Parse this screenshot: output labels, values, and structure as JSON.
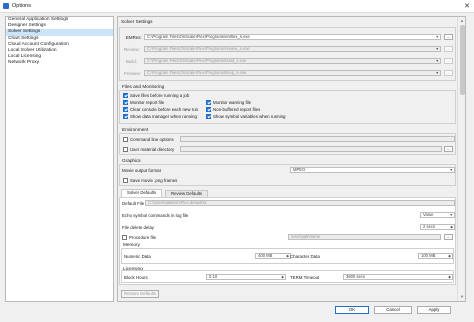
{
  "window": {
    "title": "Options"
  },
  "nav": {
    "items": [
      {
        "label": "General Application Settings"
      },
      {
        "label": "Designer Settings"
      },
      {
        "label": "Solver Settings"
      },
      {
        "label": "Chart Settings"
      },
      {
        "label": "Cloud Account Configuration"
      },
      {
        "label": "Local Solver Utilization"
      },
      {
        "label": "Local Licensing"
      },
      {
        "label": "Network Proxy"
      }
    ],
    "selected": "Solver Settings"
  },
  "solver": {
    "heading": "Solver Settings",
    "paths": [
      {
        "label": "EMRes:",
        "value": "C:\\Program Files\\OnScale\\Flex\\Programs\\emflex_s.exe",
        "enabled": true
      },
      {
        "label": "Review:",
        "value": "C:\\Program Files\\OnScale\\Flex\\Programs\\review_s.exe",
        "enabled": false
      },
      {
        "label": "Build:",
        "value": "C:\\Program Files\\OnScale\\Flex\\Programs\\build_s.exe",
        "enabled": false
      },
      {
        "label": "Preview:",
        "value": "C:\\Program Files\\OnScale\\Flex\\Programs\\flexp_s.exe",
        "enabled": false
      }
    ],
    "dots_label": "..."
  },
  "files": {
    "heading": "Files and Monitoring",
    "left": [
      {
        "label": "Save files before running a job",
        "checked": true
      },
      {
        "label": "Monitor report file",
        "checked": true
      },
      {
        "label": "Clear console before each new run",
        "checked": true
      },
      {
        "label": "Show data manager when running",
        "checked": true
      }
    ],
    "right": [
      {
        "label": "Monitor warning file",
        "checked": true
      },
      {
        "label": "Non-buffered report files",
        "checked": true
      },
      {
        "label": "Show symbol variables when running",
        "checked": true
      }
    ]
  },
  "environment": {
    "heading": "Environment",
    "options": [
      {
        "label": "Command line options",
        "checked": false
      },
      {
        "label": "User material directory",
        "checked": false
      }
    ]
  },
  "graphics": {
    "heading": "Graphics",
    "movie_format_label": "Movie output format",
    "movie_format_value": "MPEG",
    "save_png_label": "Save movie .png frames",
    "save_png_checked": false
  },
  "tabs": [
    {
      "label": "Solver Defaults",
      "active": true
    },
    {
      "label": "Review Defaults",
      "active": false
    }
  ],
  "defaults": {
    "default_file_label": "Default File",
    "default_file_value": "C:\\Users\\aallison\\Flex.defaultsx",
    "echo_label": "Echo symbol commands in log file",
    "echo_value": "Value",
    "delete_delay_label": "File delete delay",
    "delete_delay_value": "2 secs",
    "procedure_label": "Procedure file",
    "procedure_checked": false,
    "procedure_value": "\\user\\pathname",
    "memory_heading": "Memory",
    "numeric_label": "Numeric Data",
    "numeric_value": "400 MB",
    "character_label": "Character Data",
    "character_value": "100 MB",
    "licensing_heading": "Licensing",
    "block_hours_label": "Block Hours",
    "block_hours_value": "0.10",
    "term_timeout_label": "TERM Timeout",
    "term_timeout_value": "3600 secs"
  },
  "buttons": {
    "restore": "Restore Defaults",
    "ok": "OK",
    "cancel": "Cancel",
    "apply": "Apply"
  }
}
